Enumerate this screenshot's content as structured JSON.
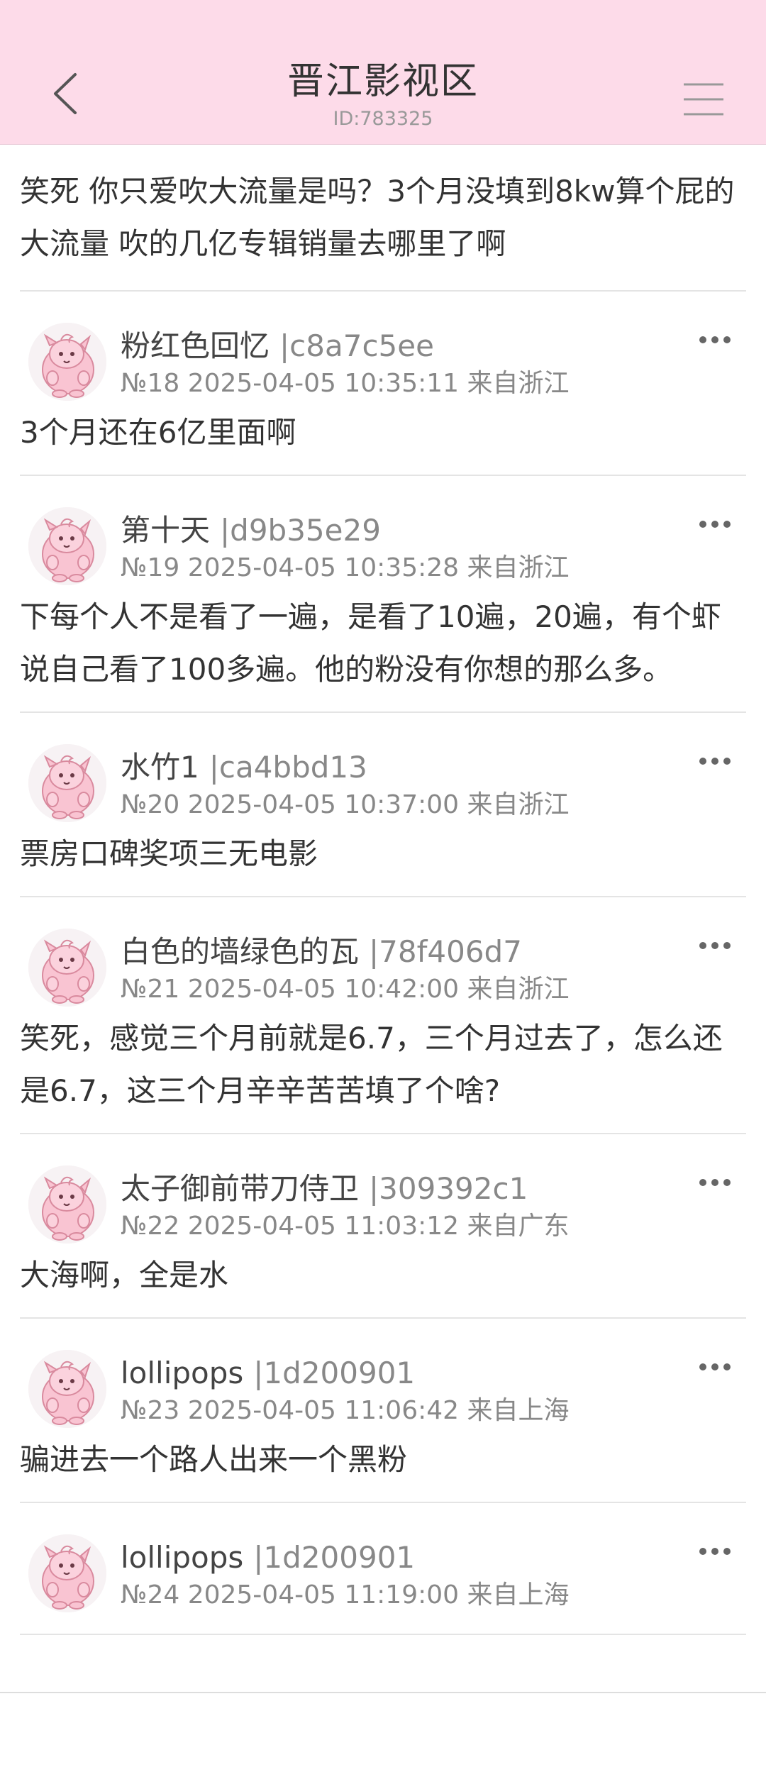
{
  "header": {
    "title": "晋江影视区",
    "subtitle": "ID:783325",
    "back_icon": "back-chevron-icon",
    "menu_icon": "hamburger-menu-icon",
    "background_color": "#fddbe9"
  },
  "top_post": {
    "text": "笑死 你只爱吹大流量是吗？3个月没填到8kw算个屁的大流量 吹的几亿专辑销量去哪里了啊"
  },
  "replies": [
    {
      "username": "粉红色回忆",
      "userid": "|c8a7c5ee",
      "meta": "№18 2025-04-05 10:35:11 来自浙江",
      "text": "3个月还在6亿里面啊"
    },
    {
      "username": "第十天",
      "userid": "|d9b35e29",
      "meta": "№19 2025-04-05 10:35:28 来自浙江",
      "text": "下每个人不是看了一遍，是看了10遍，20遍，有个虾说自己看了100多遍。他的粉没有你想的那么多。"
    },
    {
      "username": "水竹1",
      "userid": "|ca4bbd13",
      "meta": "№20 2025-04-05 10:37:00 来自浙江",
      "text": "票房口碑奖项三无电影"
    },
    {
      "username": "白色的墙绿色的瓦",
      "userid": "|78f406d7",
      "meta": "№21 2025-04-05 10:42:00 来自浙江",
      "text": "笑死，感觉三个月前就是6.7，三个月过去了，怎么还是6.7，这三个月辛辛苦苦填了个啥?"
    },
    {
      "username": "太子御前带刀侍卫",
      "userid": "|309392c1",
      "meta": "№22 2025-04-05 11:03:12 来自广东",
      "text": "大海啊，全是水"
    },
    {
      "username": "lollipops",
      "userid": "|1d200901",
      "meta": "№23 2025-04-05 11:06:42 来自上海",
      "text": "骗进去一个路人出来一个黑粉"
    },
    {
      "username": "lollipops",
      "userid": "|1d200901",
      "meta": "№24 2025-04-05 11:19:00 来自上海",
      "text": ""
    }
  ]
}
